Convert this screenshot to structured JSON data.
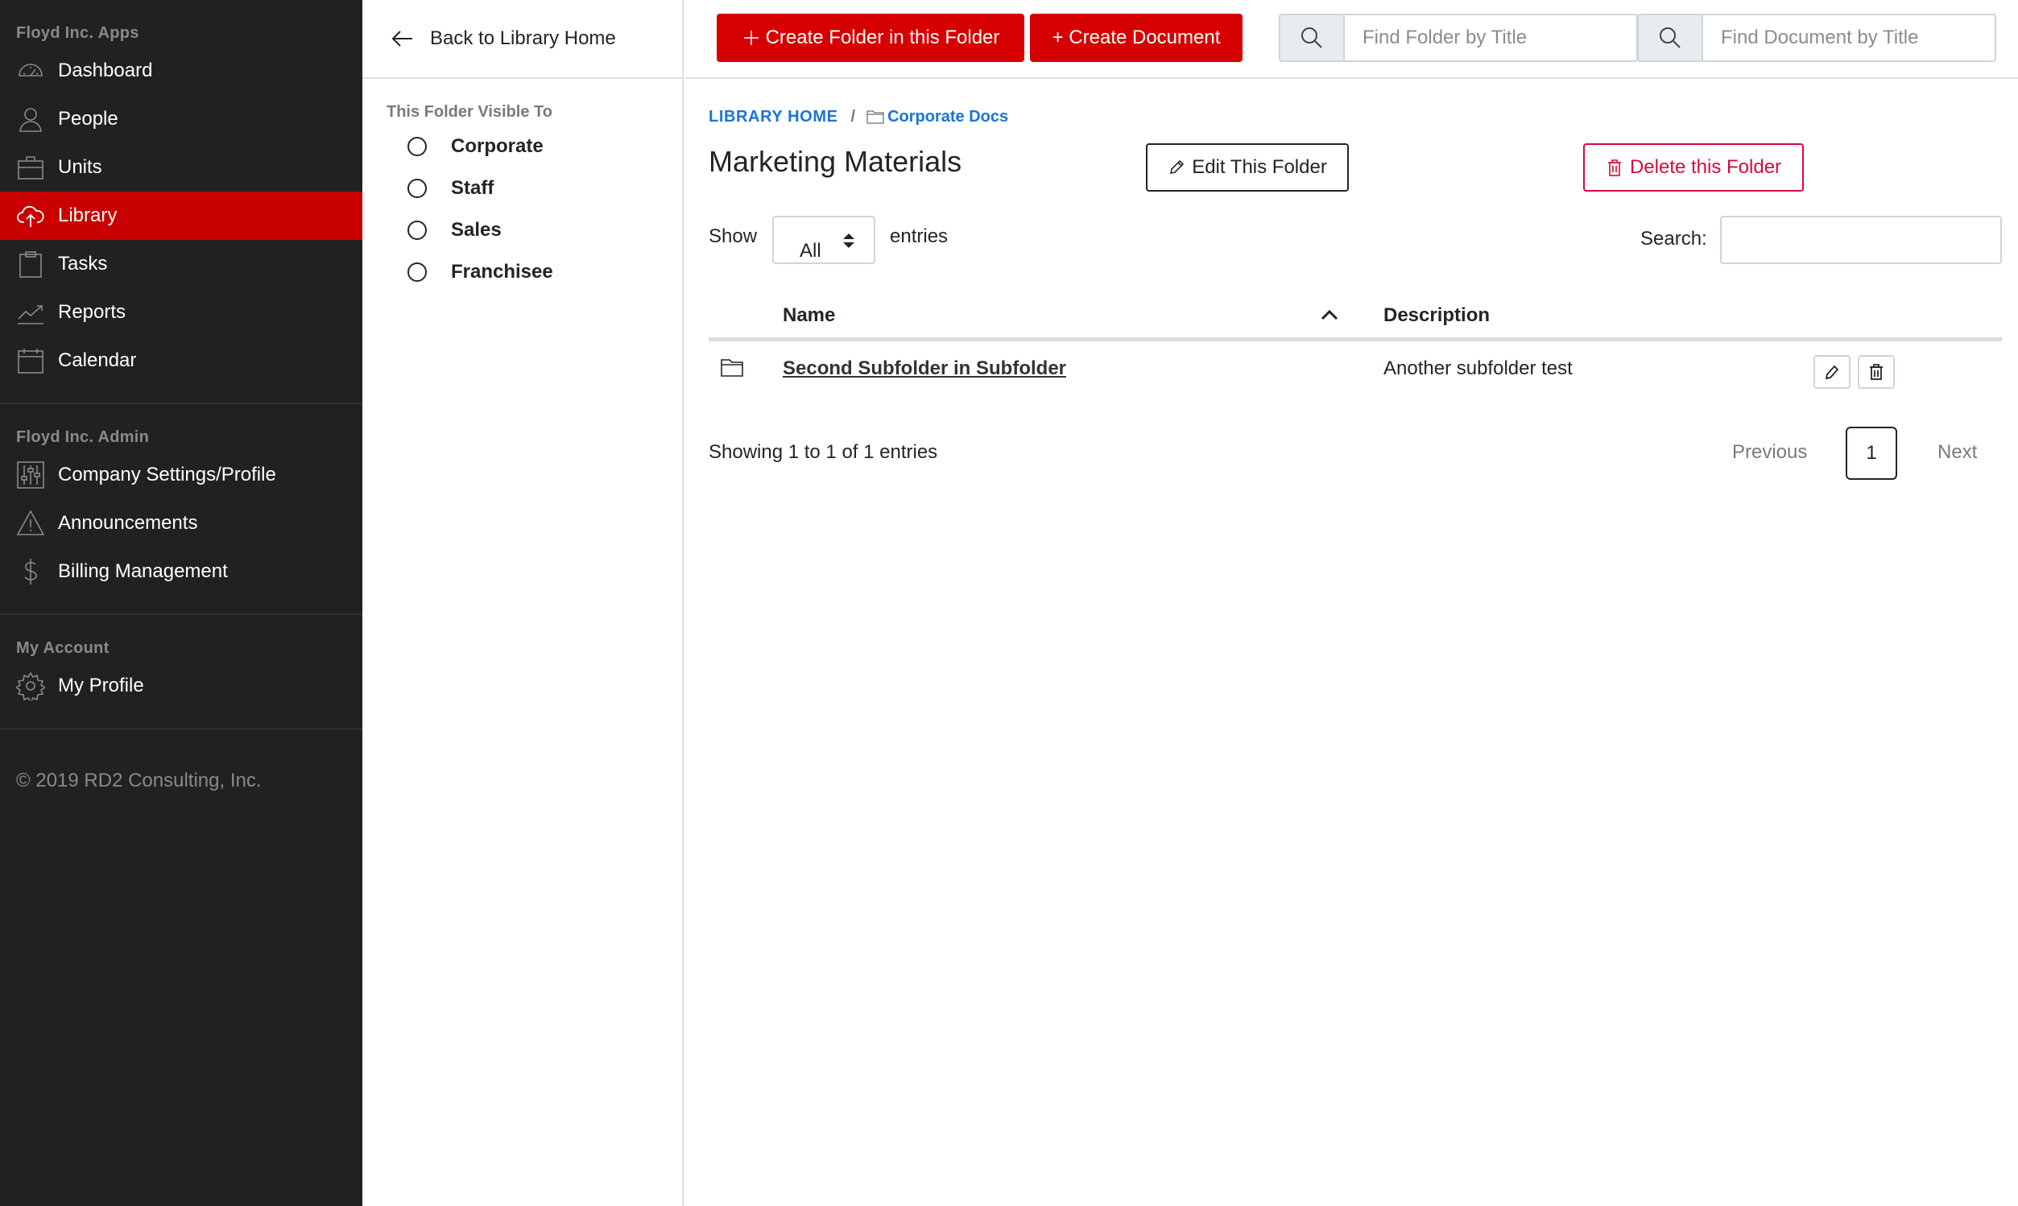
{
  "sidebar": {
    "sections": [
      {
        "heading": "Floyd Inc. Apps",
        "items": [
          {
            "label": "Dashboard",
            "icon": "dashboard-icon"
          },
          {
            "label": "People",
            "icon": "person-icon"
          },
          {
            "label": "Units",
            "icon": "briefcase-icon"
          },
          {
            "label": "Library",
            "icon": "cloud-upload-icon",
            "active": true
          },
          {
            "label": "Tasks",
            "icon": "clipboard-icon"
          },
          {
            "label": "Reports",
            "icon": "trend-icon"
          },
          {
            "label": "Calendar",
            "icon": "calendar-icon"
          }
        ]
      },
      {
        "heading": "Floyd Inc. Admin",
        "items": [
          {
            "label": "Company Settings/Profile",
            "icon": "sliders-icon"
          },
          {
            "label": "Announcements",
            "icon": "warning-icon"
          },
          {
            "label": "Billing Management",
            "icon": "dollar-icon"
          }
        ]
      },
      {
        "heading": "My Account",
        "items": [
          {
            "label": "My Profile",
            "icon": "gear-icon"
          }
        ]
      }
    ],
    "footer": "© 2019 RD2 Consulting, Inc."
  },
  "folder_panel": {
    "back_label": "Back to Library Home",
    "visible_heading": "This Folder Visible To",
    "options": [
      "Corporate",
      "Staff",
      "Sales",
      "Franchisee"
    ]
  },
  "topbar": {
    "create_folder_label": "Create Folder in this Folder",
    "create_document_label": "+ Create Document",
    "find_folder_placeholder": "Find Folder by Title",
    "find_document_placeholder": "Find Document by Title"
  },
  "main": {
    "breadcrumb_home": "LIBRARY HOME",
    "breadcrumb_sep": "/",
    "breadcrumb_folder": "Corporate Docs",
    "title": "Marketing Materials",
    "edit_label": "Edit This Folder",
    "delete_label": "Delete this Folder",
    "show_label": "Show",
    "show_value": "All",
    "entries_label": "entries",
    "search_label": "Search:",
    "table": {
      "headers": {
        "name": "Name",
        "description": "Description"
      },
      "rows": [
        {
          "name": "Second Subfolder in Subfolder",
          "description": "Another subfolder test"
        }
      ]
    },
    "info": "Showing 1 to 1 of 1 entries",
    "pager": {
      "previous": "Previous",
      "page": "1",
      "next": "Next"
    }
  },
  "colors": {
    "sidebar_bg": "#212121",
    "accent_red": "#d70000",
    "active_item": "#c90000",
    "link_blue": "#1a73d9",
    "danger": "#d70a3a"
  }
}
